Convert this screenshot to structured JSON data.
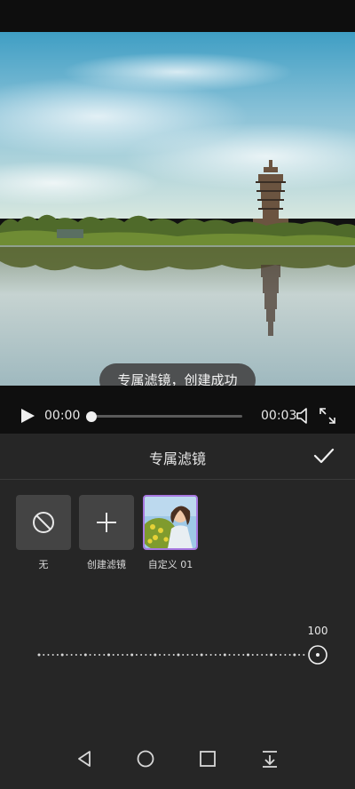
{
  "video": {
    "toast": "专属滤镜，创建成功"
  },
  "player": {
    "current_time": "00:00",
    "total_time": "00:03",
    "progress": 0,
    "icons": [
      "play-icon",
      "volume-icon",
      "fullscreen-icon"
    ]
  },
  "panel": {
    "title": "专属滤镜",
    "confirm_icon": "checkmark-icon",
    "filters": [
      {
        "label": "无",
        "icon": "none-icon"
      },
      {
        "label": "创建滤镜",
        "icon": "plus-icon"
      },
      {
        "label": "自定义 01",
        "icon": "thumbnail",
        "selected": true
      }
    ],
    "intensity": {
      "value": "100",
      "level": 1.0
    },
    "accent_color": "#a778e0"
  },
  "nav": {
    "icons": [
      "back-icon",
      "home-icon",
      "recents-icon",
      "menu-down-icon"
    ]
  }
}
